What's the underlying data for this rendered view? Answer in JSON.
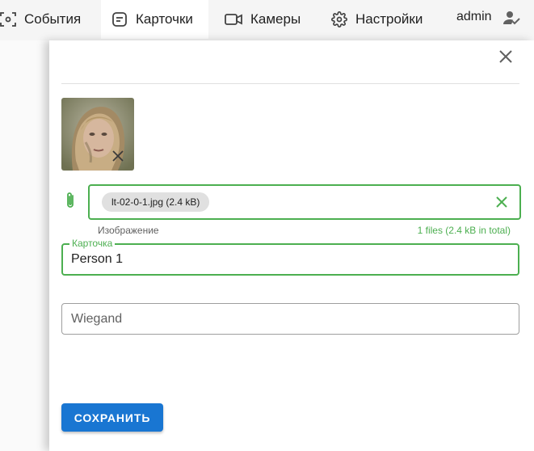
{
  "nav": {
    "tabs": [
      {
        "label": "События",
        "icon": "face-scan-icon",
        "active": false
      },
      {
        "label": "Карточки",
        "icon": "card-icon",
        "active": true
      },
      {
        "label": "Камеры",
        "icon": "camera-icon",
        "active": false
      },
      {
        "label": "Настройки",
        "icon": "gear-icon",
        "active": false
      }
    ],
    "user": {
      "name": "admin",
      "icon": "user-check-icon"
    }
  },
  "drawer": {
    "close_icon": "close-icon",
    "photo": {
      "description": "face",
      "remove_icon": "remove-icon"
    },
    "file_input": {
      "icon": "paperclip-icon",
      "chip": "lt-02-0-1.jpg (2.4 kB)",
      "clear_icon": "clear-icon",
      "hint": "Изображение",
      "count": "1 files (2.4 kB in total)"
    },
    "card_field": {
      "label": "Карточка",
      "value": "Person 1"
    },
    "wiegand_field": {
      "placeholder": "Wiegand"
    },
    "save_button": "СОХРАНИТЬ"
  },
  "colors": {
    "accent_green": "#4caf50",
    "primary_blue": "#1976d2",
    "topbar_bg": "#f5f5f5"
  }
}
